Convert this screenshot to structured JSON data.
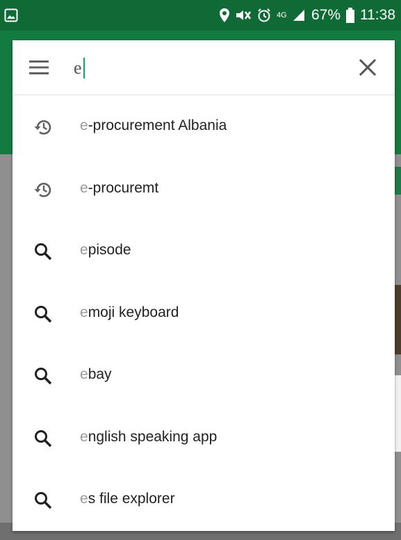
{
  "status_bar": {
    "network": "4G",
    "battery_percent": "67%",
    "time": "11:38"
  },
  "search": {
    "query": "e",
    "menu_icon": "hamburger-menu-icon",
    "clear_icon": "close-icon"
  },
  "suggestions": [
    {
      "icon": "history-icon",
      "prefix": "e",
      "rest": "-procurement Albania"
    },
    {
      "icon": "history-icon",
      "prefix": "e",
      "rest": "-procuremt"
    },
    {
      "icon": "search-icon",
      "prefix": "e",
      "rest": "pisode"
    },
    {
      "icon": "search-icon",
      "prefix": "e",
      "rest": "moji keyboard"
    },
    {
      "icon": "search-icon",
      "prefix": "e",
      "rest": "bay"
    },
    {
      "icon": "search-icon",
      "prefix": "e",
      "rest": "nglish speaking app"
    },
    {
      "icon": "search-icon",
      "prefix": "e",
      "rest": "s file explorer"
    }
  ]
}
